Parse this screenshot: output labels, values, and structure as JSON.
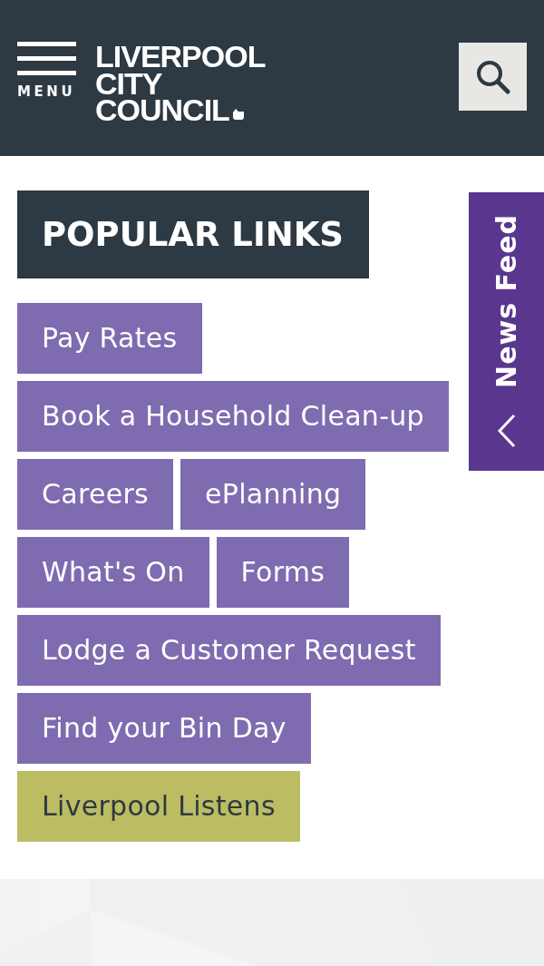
{
  "header": {
    "menu_label": "MENU",
    "logo_lines": [
      "LIVERPOOL",
      "CITY",
      "COUNCIL"
    ]
  },
  "popular_links": {
    "title": "POPULAR LINKS",
    "links": [
      {
        "label": "Pay Rates",
        "kind": "standard"
      },
      {
        "label": "Book a Household Clean-up",
        "kind": "standard"
      },
      {
        "label": "Careers",
        "kind": "standard"
      },
      {
        "label": "ePlanning",
        "kind": "standard"
      },
      {
        "label": "What's On",
        "kind": "standard"
      },
      {
        "label": "Forms",
        "kind": "standard"
      },
      {
        "label": "Lodge a Customer Request",
        "kind": "standard"
      },
      {
        "label": "Find your Bin Day",
        "kind": "standard"
      },
      {
        "label": "Liverpool Listens",
        "kind": "featured"
      }
    ]
  },
  "news_feed_tab": {
    "label": "News Feed"
  }
}
